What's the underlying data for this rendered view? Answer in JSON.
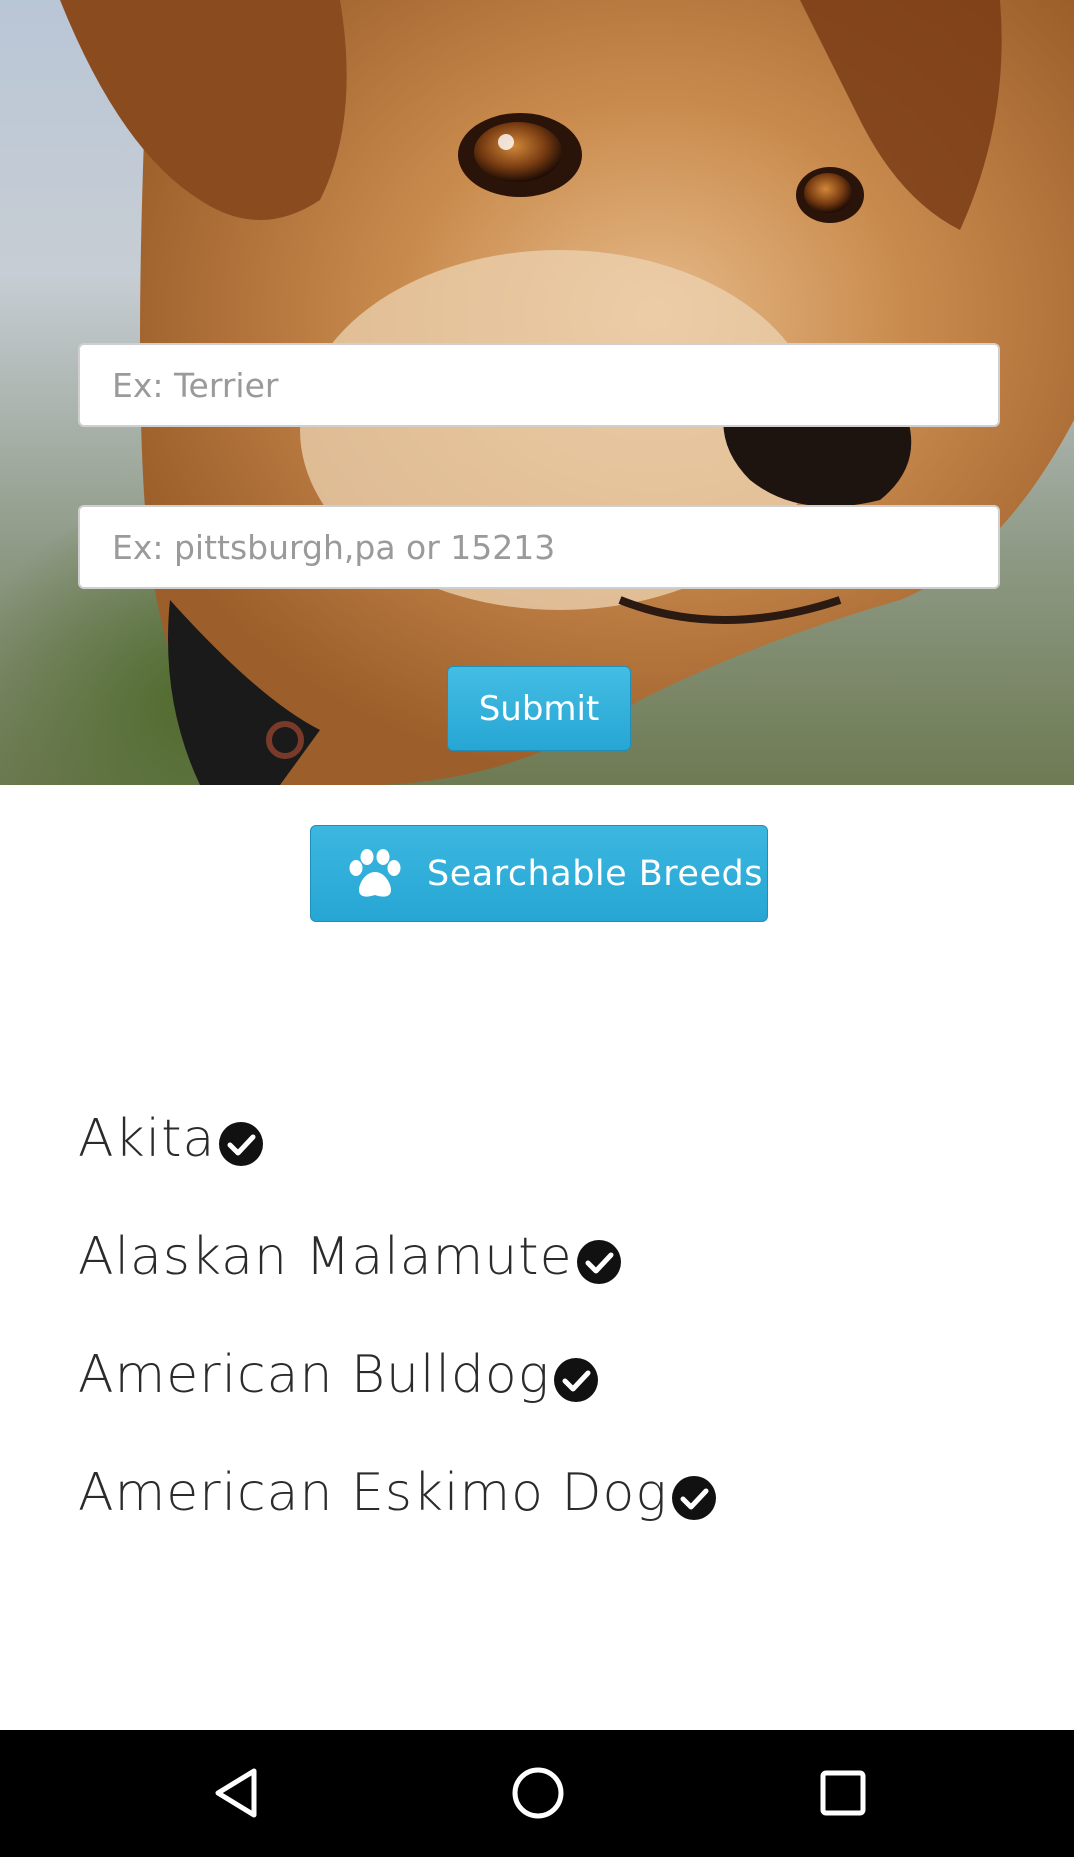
{
  "search": {
    "breed_placeholder": "Ex: Terrier",
    "location_placeholder": "Ex: pittsburgh,pa or 15213",
    "submit_label": "Submit"
  },
  "breeds_button": {
    "icon": "paw-icon",
    "label": "Searchable Breeds"
  },
  "breeds": [
    {
      "name": "Akita",
      "icon": "check-circle-icon"
    },
    {
      "name": "Alaskan Malamute",
      "icon": "check-circle-icon"
    },
    {
      "name": "American Bulldog",
      "icon": "check-circle-icon"
    },
    {
      "name": "American Eskimo Dog",
      "icon": "check-circle-icon"
    }
  ],
  "navbar": {
    "items": [
      "back-icon",
      "home-icon",
      "recents-icon"
    ]
  },
  "colors": {
    "accent": "#2aa8d6",
    "text": "#2b2b2b",
    "navbar": "#000000"
  }
}
